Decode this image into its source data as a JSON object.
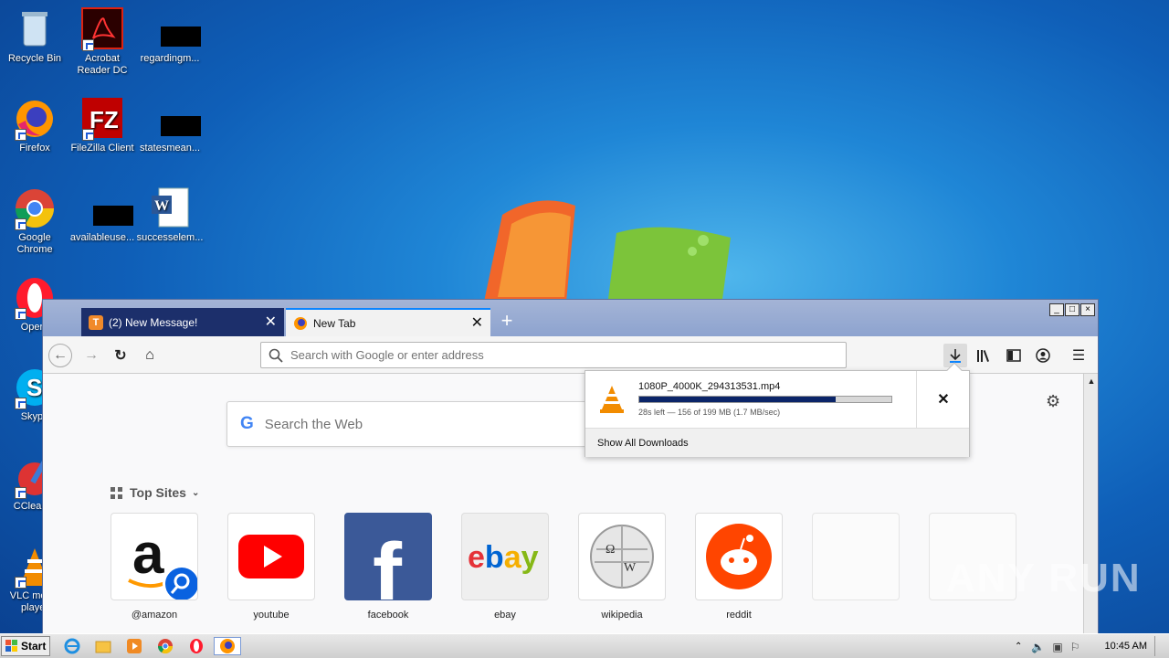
{
  "desktop": {
    "icons": [
      {
        "label": "Recycle Bin"
      },
      {
        "label": "Acrobat Reader DC"
      },
      {
        "label": "regardingm..."
      },
      {
        "label": "Firefox"
      },
      {
        "label": "FileZilla Client"
      },
      {
        "label": "statesmean..."
      },
      {
        "label": "Google Chrome"
      },
      {
        "label": "availableuse..."
      },
      {
        "label": "successelem..."
      },
      {
        "label": "Opera"
      },
      {
        "label": "Skype"
      },
      {
        "label": "CCleaner"
      },
      {
        "label": "VLC media player"
      }
    ]
  },
  "browser": {
    "tabs": [
      {
        "label": "(2) New Message!"
      },
      {
        "label": "New Tab"
      }
    ],
    "window_buttons": [
      "_",
      "□",
      "×"
    ],
    "urlbar": {
      "placeholder": "Search with Google or enter address"
    },
    "search": {
      "placeholder": "Search the Web",
      "logo": "G"
    },
    "top_sites": {
      "heading": "Top Sites",
      "tiles": [
        {
          "label": "@amazon"
        },
        {
          "label": "youtube"
        },
        {
          "label": "facebook"
        },
        {
          "label": "ebay"
        },
        {
          "label": "wikipedia"
        },
        {
          "label": "reddit"
        }
      ]
    }
  },
  "download_panel": {
    "filename": "1080P_4000K_294313531.mp4",
    "status": "28s left — 156 of 199 MB (1.7 MB/sec)",
    "progress_fraction": 0.78,
    "show_all": "Show All Downloads"
  },
  "taskbar": {
    "start": "Start",
    "clock": "10:45 AM"
  },
  "watermark": "ANY RUN",
  "colors": {
    "active_tab_bg": "#1c2f6b",
    "progress_fill": "#0b2569",
    "firefox_accent": "#0a84ff"
  }
}
